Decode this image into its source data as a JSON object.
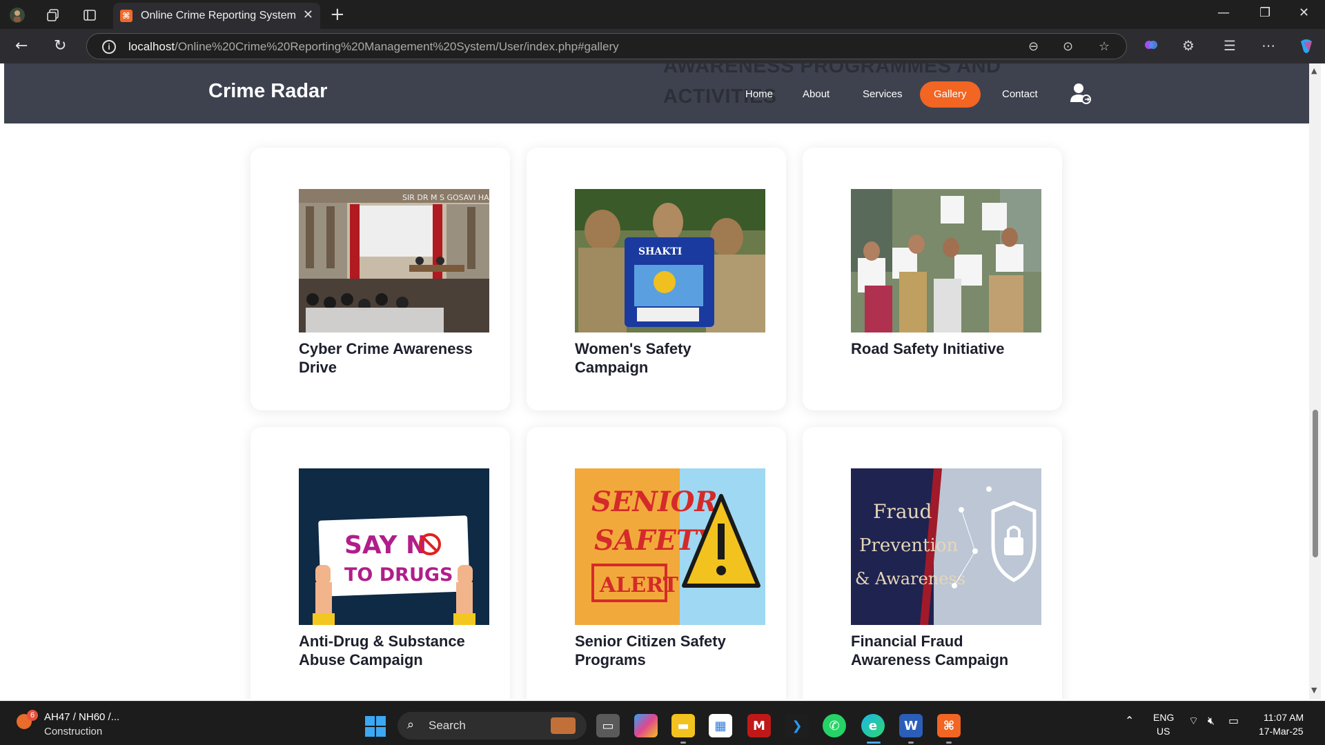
{
  "browser": {
    "tab_title": "Online Crime Reporting System",
    "url_host": "localhost",
    "url_path": "/Online%20Crime%20Reporting%20Management%20System/User/index.php#gallery"
  },
  "site": {
    "brand": "Crime Radar",
    "ghost_heading_line1": "AWARENESS PROGRAMMES AND",
    "ghost_heading_line2": "ACTIVITIES",
    "nav": [
      "Home",
      "About",
      "Services",
      "Gallery",
      "Contact"
    ],
    "active_nav": "Gallery",
    "accent_color": "#f26522",
    "header_color": "#3e424f"
  },
  "gallery": {
    "cards": [
      {
        "title": "Cyber Crime Awareness Drive",
        "image": "seminar-hall-photo"
      },
      {
        "title": "Women's Safety Campaign",
        "image": "police-women-shakti-team-photo"
      },
      {
        "title": "Road Safety Initiative",
        "image": "road-safety-rally-photo"
      },
      {
        "title": "Anti-Drug & Substance Abuse Campaign",
        "image": "say-no-to-drugs-poster",
        "poster_line1": "SAY N",
        "poster_line2": "TO DRUGS"
      },
      {
        "title": "Senior Citizen Safety Programs",
        "image": "senior-safety-alert-poster",
        "poster_line1": "SENIOR",
        "poster_line2": "SAFETY",
        "poster_line3": "ALERT"
      },
      {
        "title": "Financial Fraud Awareness Campaign",
        "image": "fraud-prevention-poster",
        "poster_line1": "Fraud",
        "poster_line2": "Prevention",
        "poster_line3": "& Awareness"
      }
    ]
  },
  "taskbar": {
    "weather_badge": "6",
    "weather_line1": "AH47 / NH60 /...",
    "weather_line2": "Construction",
    "search_placeholder": "Search",
    "lang1": "ENG",
    "lang2": "US",
    "time": "11:07 AM",
    "date": "17-Mar-25"
  }
}
